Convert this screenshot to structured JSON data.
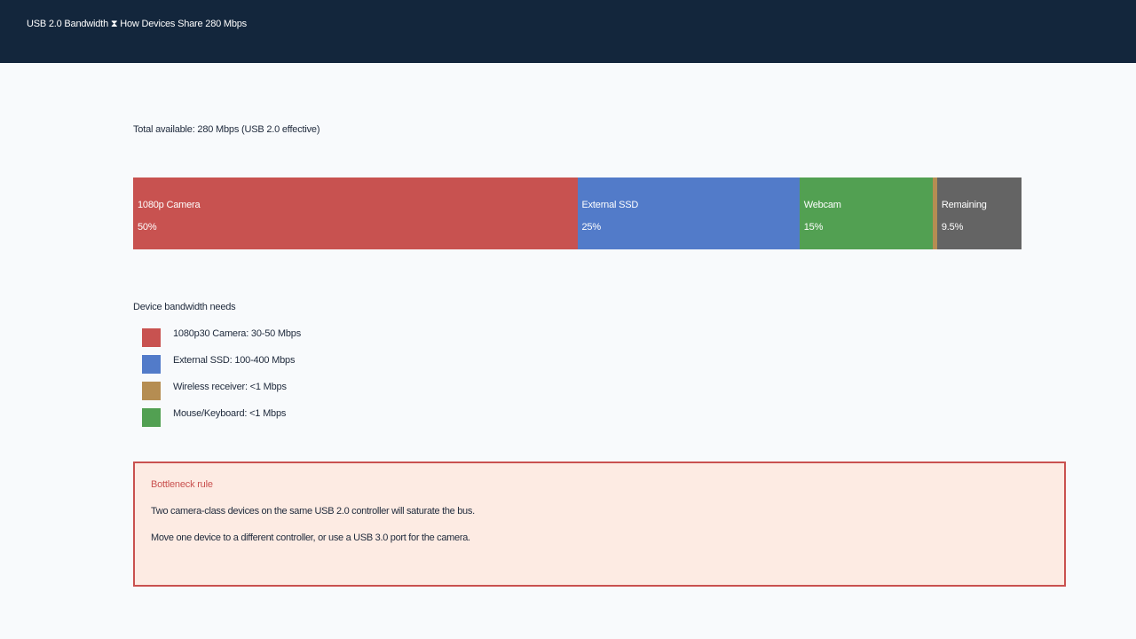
{
  "header": {
    "title": "USB 2.0 Bandwidth ⧗ How Devices Share 280 Mbps"
  },
  "total_label": "Total available: 280 Mbps (USB 2.0 effective)",
  "chart_data": {
    "type": "bar",
    "stacked": true,
    "orientation": "horizontal",
    "total": 100,
    "segments": [
      {
        "label": "1080p Camera",
        "value": 50,
        "display": "50%",
        "color": "#c85250"
      },
      {
        "label": "External SSD",
        "value": 25,
        "display": "25%",
        "color": "#527bc9"
      },
      {
        "label": "Webcam",
        "value": 15,
        "display": "15%",
        "color": "#52a052"
      },
      {
        "label": "",
        "value": 0.5,
        "display": "",
        "color": "#b58d52"
      },
      {
        "label": "Remaining",
        "value": 9.5,
        "display": "9.5%",
        "color": "#646464"
      }
    ]
  },
  "legend": {
    "title": "Device bandwidth needs",
    "items": [
      {
        "label": "1080p30 Camera: 30-50 Mbps",
        "color": "#c85250"
      },
      {
        "label": "External SSD: 100-400 Mbps",
        "color": "#527bc9"
      },
      {
        "label": "Wireless receiver: <1 Mbps",
        "color": "#b58d52"
      },
      {
        "label": "Mouse/Keyboard: <1 Mbps",
        "color": "#52a052"
      }
    ]
  },
  "callout": {
    "title": "Bottleneck rule",
    "line1": "Two camera-class devices on the same USB 2.0 controller will saturate the bus.",
    "line2": "Move one device to a different controller, or use a USB 3.0 port for the camera."
  }
}
